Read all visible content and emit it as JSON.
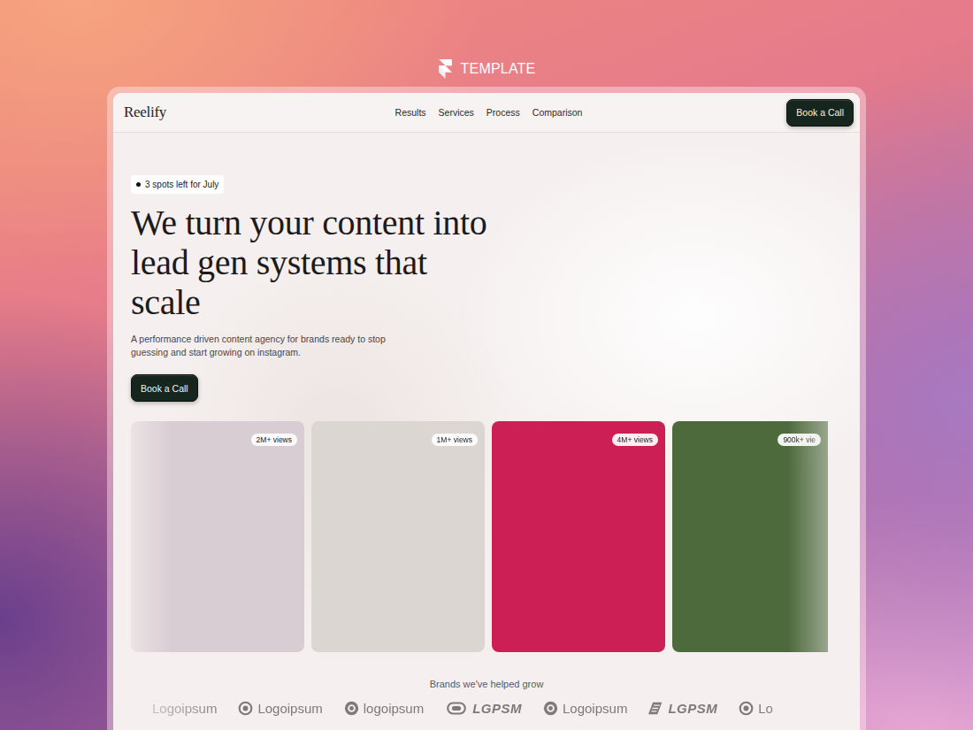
{
  "showcase": {
    "label": "TEMPLATE"
  },
  "nav": {
    "brand": "Reelify",
    "links": [
      "Results",
      "Services",
      "Process",
      "Comparison"
    ],
    "cta": "Book a Call"
  },
  "hero": {
    "availability": "3 spots left for July",
    "title": "We turn your content into lead gen systems that scale",
    "subtitle": "A performance driven content agency for brands ready to stop guessing and start growing on instagram.",
    "cta": "Book a Call"
  },
  "cards": [
    {
      "views": "2M+ views",
      "color": "#d8cdd3"
    },
    {
      "views": "1M+ views",
      "color": "#dcd6d2"
    },
    {
      "views": "4M+ views",
      "color": "#cc1f55"
    },
    {
      "views": "900k+ vie",
      "color": "#4d6a3c"
    }
  ],
  "brands": {
    "title": "Brands we've helped grow",
    "logos": [
      {
        "name": "Logoipsum",
        "kind": "none"
      },
      {
        "name": "Logoipsum",
        "kind": "ring"
      },
      {
        "name": "logoipsum",
        "kind": "circle"
      },
      {
        "name": "LGPSM",
        "kind": "pill"
      },
      {
        "name": "Logoipsum",
        "kind": "circle"
      },
      {
        "name": "LGPSM",
        "kind": "stripes"
      },
      {
        "name": "Lo",
        "kind": "ring"
      }
    ]
  }
}
